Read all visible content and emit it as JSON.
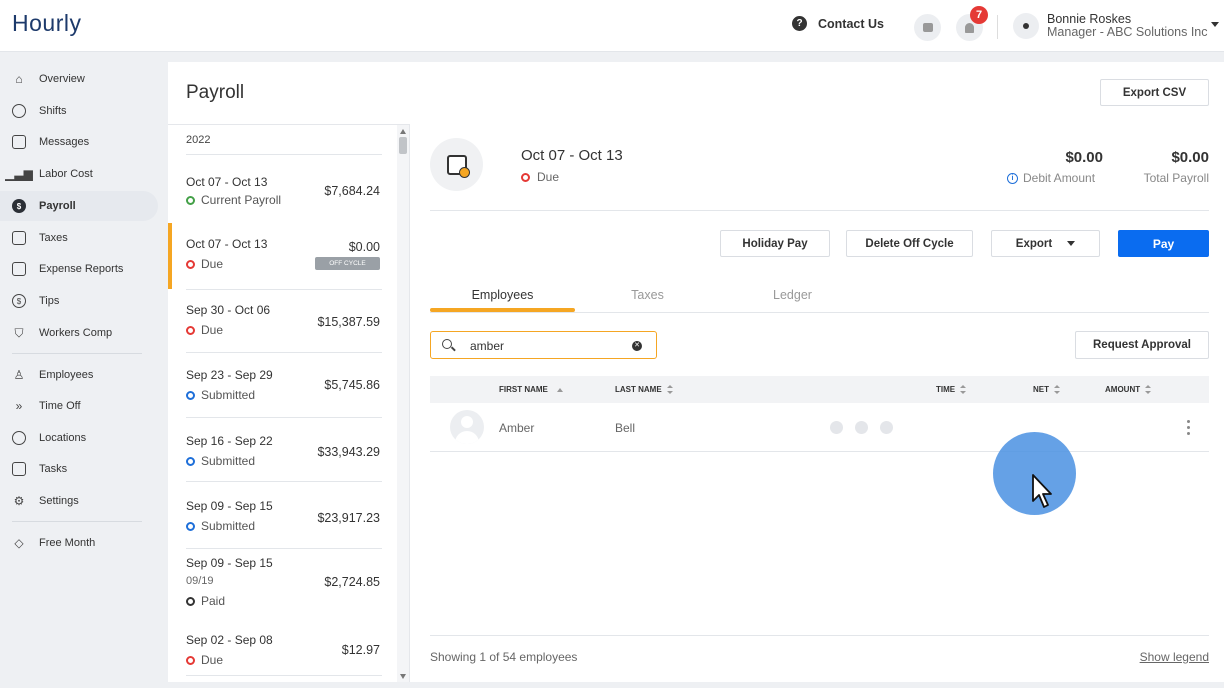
{
  "app": {
    "name": "Hourly"
  },
  "header": {
    "contact_label": "Contact Us",
    "notifications_count": "7",
    "user_name": "Bonnie Roskes",
    "user_role": "Manager - ABC Solutions Inc"
  },
  "sidebar": {
    "items": [
      {
        "label": "Overview",
        "icon": "home-icon"
      },
      {
        "label": "Shifts",
        "icon": "clock-icon"
      },
      {
        "label": "Messages",
        "icon": "chat-icon"
      },
      {
        "label": "Labor Cost",
        "icon": "bar-chart-icon"
      },
      {
        "label": "Payroll",
        "icon": "dollar-circle-icon",
        "active": true
      },
      {
        "label": "Taxes",
        "icon": "document-icon"
      },
      {
        "label": "Expense Reports",
        "icon": "folder-icon"
      },
      {
        "label": "Tips",
        "icon": "coin-icon"
      },
      {
        "label": "Workers Comp",
        "icon": "shield-icon"
      },
      {
        "label": "Employees",
        "icon": "person-icon"
      },
      {
        "label": "Time Off",
        "icon": "time-off-icon"
      },
      {
        "label": "Locations",
        "icon": "location-pin-icon"
      },
      {
        "label": "Tasks",
        "icon": "checklist-icon"
      },
      {
        "label": "Settings",
        "icon": "gear-icon"
      },
      {
        "label": "Free Month",
        "icon": "tag-icon"
      }
    ]
  },
  "page": {
    "title": "Payroll",
    "export_csv_label": "Export CSV"
  },
  "periods": {
    "year": "2022",
    "off_cycle_badge": "OFF CYCLE",
    "items": [
      {
        "range": "Oct 07 - Oct 13",
        "status": "Current Payroll",
        "amount": "$7,684.24"
      },
      {
        "range": "Oct 07 - Oct 13",
        "status": "Due",
        "amount": "$0.00"
      },
      {
        "range": "Sep 30 - Oct 06",
        "status": "Due",
        "amount": "$15,387.59"
      },
      {
        "range": "Sep 23 - Sep 29",
        "status": "Submitted",
        "amount": "$5,745.86"
      },
      {
        "range": "Sep 16 - Sep 22",
        "status": "Submitted",
        "amount": "$33,943.29"
      },
      {
        "range": "Sep 09 - Sep 15",
        "status": "Submitted",
        "amount": "$23,917.23"
      },
      {
        "range": "Sep 09 - Sep 15",
        "sub": "09/19",
        "status": "Paid",
        "amount": "$2,724.85"
      },
      {
        "range": "Sep 02 - Sep 08",
        "status": "Due",
        "amount": "$12.97"
      }
    ]
  },
  "detail": {
    "title": "Oct 07 - Oct 13",
    "status": "Due",
    "debit_amount": "$0.00",
    "debit_label": "Debit Amount",
    "total_payroll": "$0.00",
    "total_label": "Total Payroll",
    "actions": {
      "holiday_pay": "Holiday Pay",
      "delete_off_cycle": "Delete Off Cycle",
      "export": "Export",
      "pay": "Pay"
    },
    "tabs": [
      "Employees",
      "Taxes",
      "Ledger"
    ],
    "search_value": "amber",
    "request_approval": "Request Approval",
    "columns": [
      "FIRST NAME",
      "LAST NAME",
      "TIME",
      "NET",
      "AMOUNT"
    ],
    "rows": [
      {
        "first_name": "Amber",
        "last_name": "Bell"
      }
    ],
    "showing": "Showing 1 of 54 employees",
    "show_legend": "Show legend"
  }
}
